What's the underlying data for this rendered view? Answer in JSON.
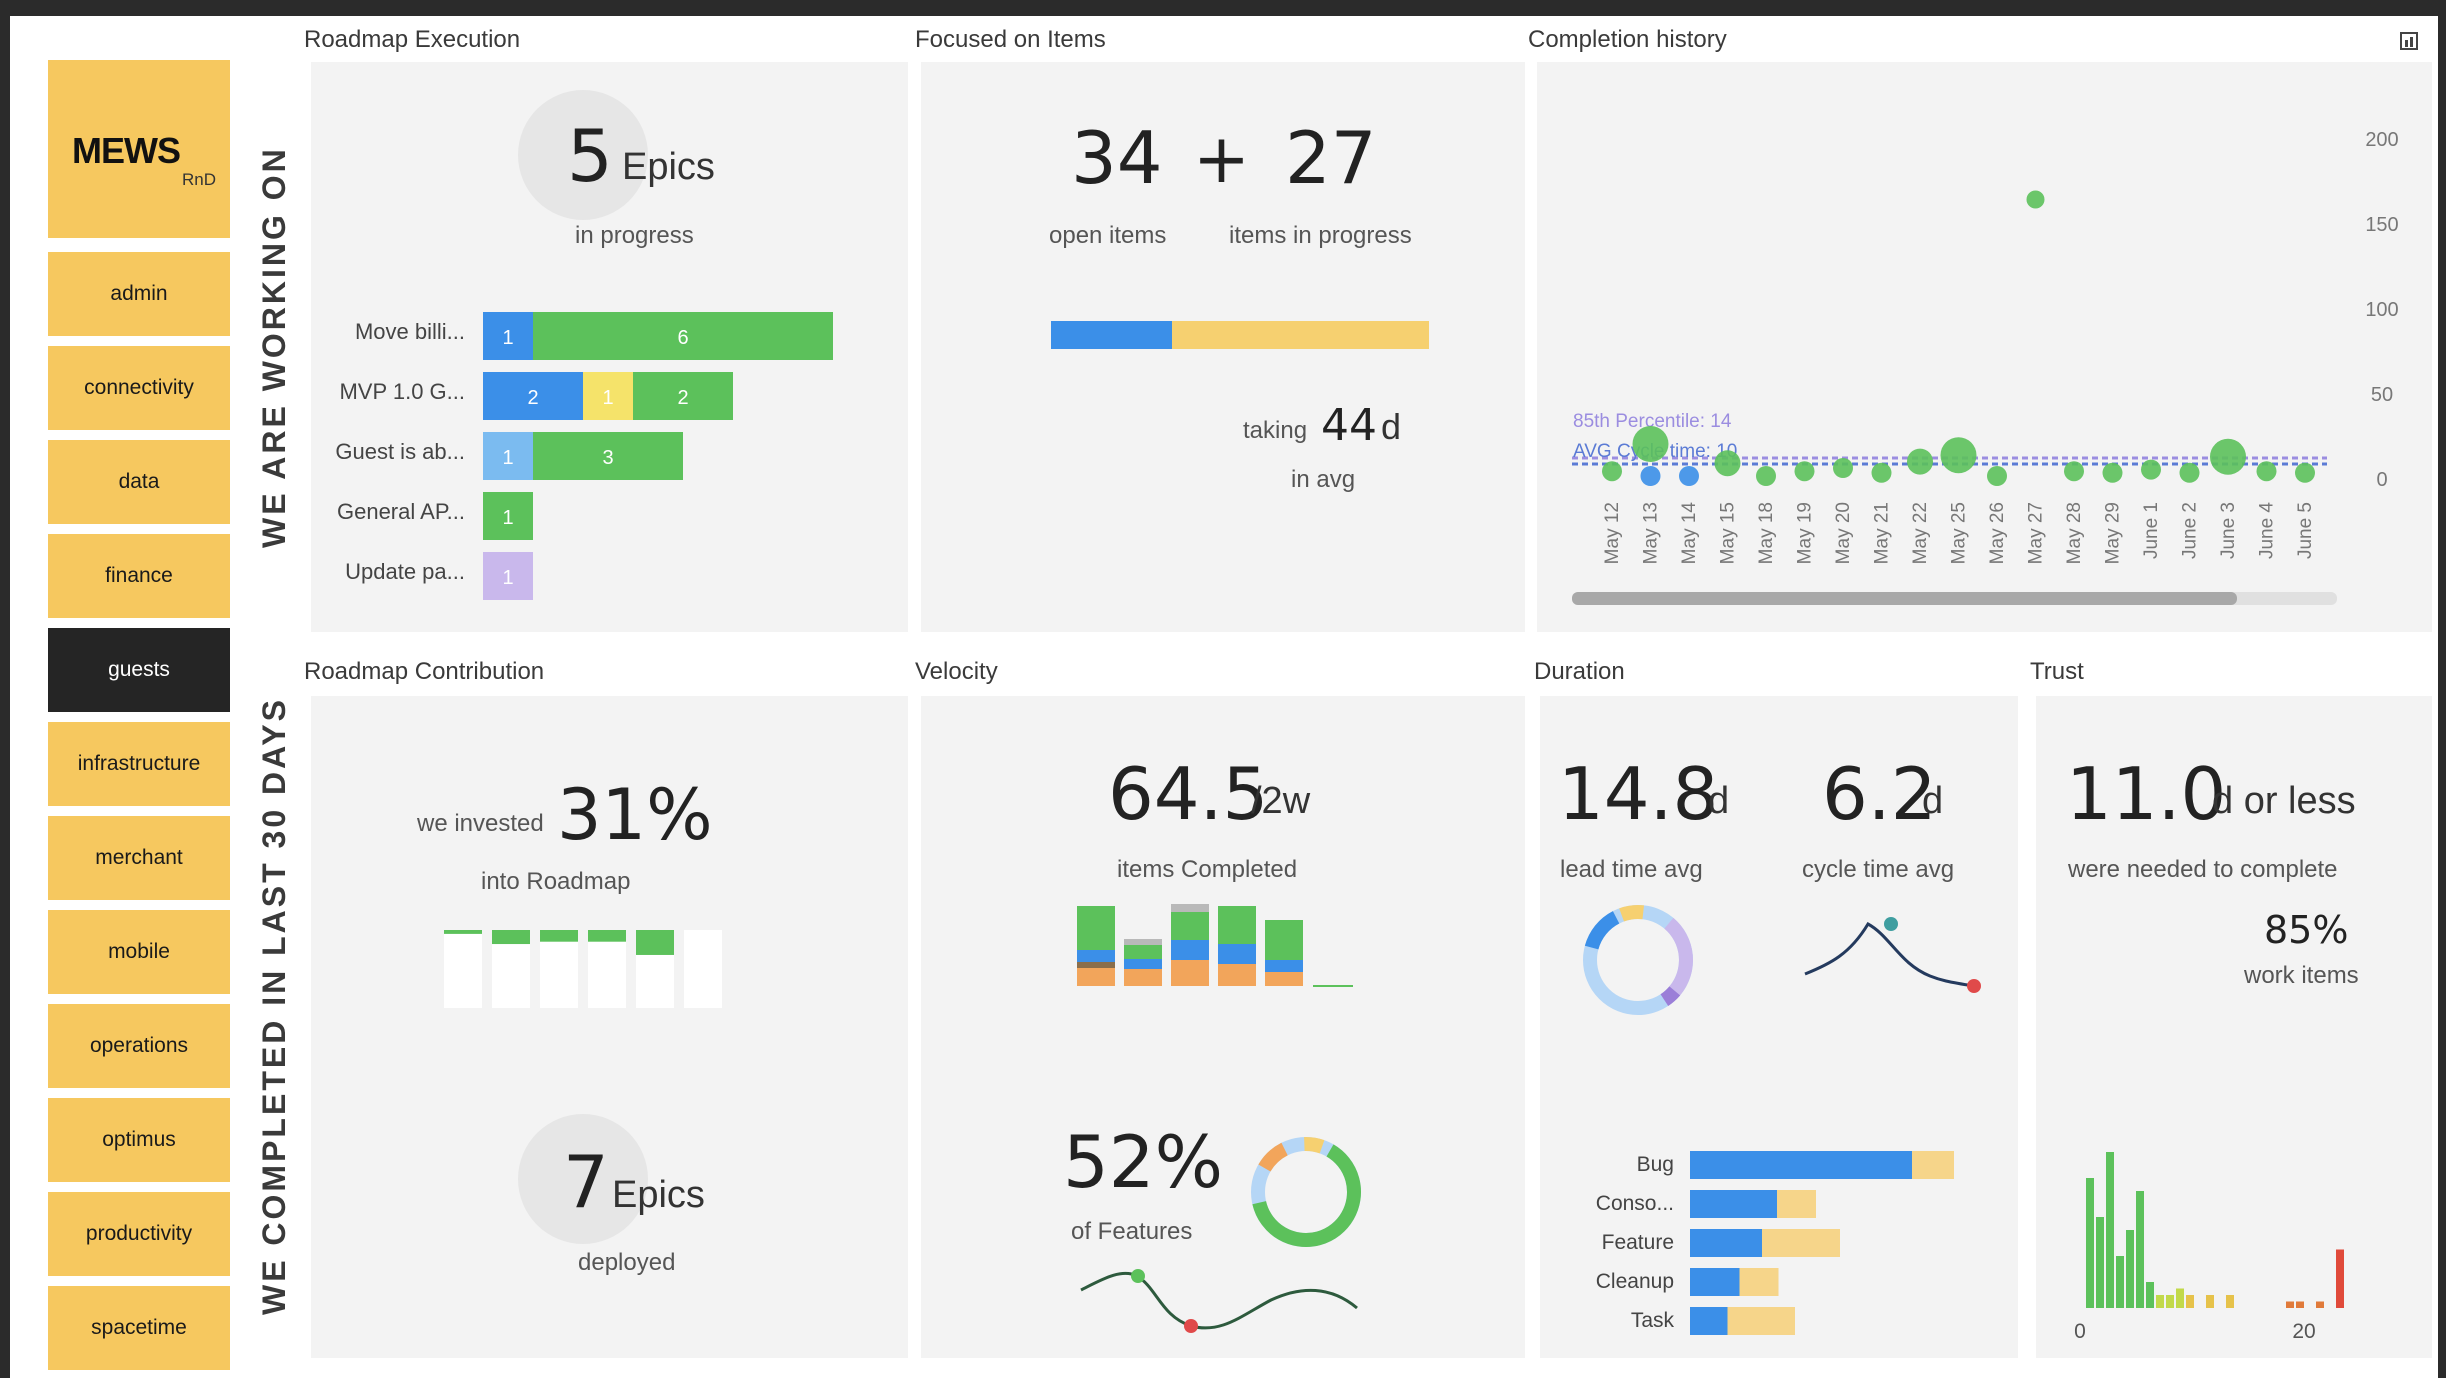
{
  "brand": {
    "name": "MEWS",
    "sub": "RnD"
  },
  "sidebar": {
    "items": [
      {
        "label": "admin",
        "active": false
      },
      {
        "label": "connectivity",
        "active": false
      },
      {
        "label": "data",
        "active": false
      },
      {
        "label": "finance",
        "active": false
      },
      {
        "label": "guests",
        "active": true
      },
      {
        "label": "infrastructure",
        "active": false
      },
      {
        "label": "merchant",
        "active": false
      },
      {
        "label": "mobile",
        "active": false
      },
      {
        "label": "operations",
        "active": false
      },
      {
        "label": "optimus",
        "active": false
      },
      {
        "label": "productivity",
        "active": false
      },
      {
        "label": "spacetime",
        "active": false
      }
    ]
  },
  "side_labels": {
    "working": "WE ARE WORKING ON",
    "completed": "WE COMPLETED IN LAST 30 DAYS"
  },
  "roadmap_execution": {
    "title": "Roadmap Execution",
    "count": "5",
    "unit": "Epics",
    "caption": "in progress",
    "bars": [
      {
        "label": "Move billi...",
        "segments": [
          {
            "value": 1,
            "color": "#3b8fe8"
          },
          {
            "value": 6,
            "color": "#5cc15b"
          }
        ]
      },
      {
        "label": "MVP 1.0 G...",
        "segments": [
          {
            "value": 2,
            "color": "#3b8fe8"
          },
          {
            "value": 1,
            "color": "#f5e36a"
          },
          {
            "value": 2,
            "color": "#5cc15b"
          }
        ]
      },
      {
        "label": "Guest is ab...",
        "segments": [
          {
            "value": 1,
            "color": "#7bbbf0"
          },
          {
            "value": 3,
            "color": "#5cc15b"
          }
        ]
      },
      {
        "label": "General AP...",
        "segments": [
          {
            "value": 1,
            "color": "#5cc15b"
          }
        ]
      },
      {
        "label": "Update pa...",
        "segments": [
          {
            "value": 1,
            "color": "#c9b8ec"
          }
        ]
      }
    ]
  },
  "focused": {
    "title": "Focused on Items",
    "open_count": "34",
    "plus": "+",
    "progress_count": "27",
    "open_label": "open items",
    "progress_label": "items in progress",
    "open_fraction": 0.32,
    "taking_label": "taking",
    "avg_days": "44",
    "avg_unit": "d",
    "avg_label": "in avg"
  },
  "completion_history": {
    "title": "Completion history",
    "chart_data": {
      "type": "scatter",
      "x": [
        "May 12",
        "May 13",
        "May 14",
        "May 15",
        "May 18",
        "May 19",
        "May 20",
        "May 21",
        "May 22",
        "May 25",
        "May 26",
        "May 27",
        "May 28",
        "May 29",
        "June 1",
        "June 2",
        "June 3",
        "June 4",
        "June 5"
      ],
      "ylim": [
        0,
        200
      ],
      "yticks": [
        "200",
        "150",
        "100",
        "50",
        "0"
      ],
      "reference_lines": [
        {
          "label": "85th Percentile: 14",
          "value": 14,
          "color": "#9b8de0"
        },
        {
          "label": "AVG Cycle time: 10",
          "value": 10,
          "color": "#5b7bd5"
        }
      ],
      "points": [
        {
          "x": "May 12",
          "y": 3,
          "color": "#5cc15b"
        },
        {
          "x": "May 13",
          "y": 20,
          "color": "#5cc15b"
        },
        {
          "x": "May 13",
          "y": 0,
          "color": "#3b8fe8"
        },
        {
          "x": "May 14",
          "y": 0,
          "color": "#3b8fe8"
        },
        {
          "x": "May 15",
          "y": 8,
          "color": "#5cc15b"
        },
        {
          "x": "May 18",
          "y": 0,
          "color": "#5cc15b"
        },
        {
          "x": "May 19",
          "y": 3,
          "color": "#5cc15b"
        },
        {
          "x": "May 20",
          "y": 5,
          "color": "#5cc15b"
        },
        {
          "x": "May 21",
          "y": 2,
          "color": "#5cc15b"
        },
        {
          "x": "May 22",
          "y": 9,
          "color": "#5cc15b"
        },
        {
          "x": "May 25",
          "y": 13,
          "color": "#5cc15b"
        },
        {
          "x": "May 26",
          "y": 0,
          "color": "#5cc15b"
        },
        {
          "x": "May 27",
          "y": 165,
          "color": "#5cc15b"
        },
        {
          "x": "May 28",
          "y": 3,
          "color": "#5cc15b"
        },
        {
          "x": "May 29",
          "y": 2,
          "color": "#5cc15b"
        },
        {
          "x": "June 1",
          "y": 4,
          "color": "#5cc15b"
        },
        {
          "x": "June 2",
          "y": 2,
          "color": "#5cc15b"
        },
        {
          "x": "June 3",
          "y": 12,
          "color": "#5cc15b"
        },
        {
          "x": "June 4",
          "y": 3,
          "color": "#5cc15b"
        },
        {
          "x": "June 5",
          "y": 2,
          "color": "#5cc15b"
        }
      ]
    }
  },
  "roadmap_contribution": {
    "title": "Roadmap Contribution",
    "prefix": "we invested",
    "percent": "31%",
    "caption": "into Roadmap",
    "bars": [
      0.05,
      0.18,
      0.15,
      0.15,
      0.32,
      0.0
    ],
    "epics_count": "7",
    "epics_unit": "Epics",
    "epics_caption": "deployed"
  },
  "velocity": {
    "title": "Velocity",
    "value": "64.5",
    "unit": "/2w",
    "caption": "items Completed",
    "features_pct": "52%",
    "features_label": "of Features"
  },
  "duration": {
    "title": "Duration",
    "lead_value": "14.8",
    "lead_unit": "d",
    "lead_label": "lead time avg",
    "cycle_value": "6.2",
    "cycle_unit": "d",
    "cycle_label": "cycle time avg",
    "chart_data": {
      "type": "bar",
      "categories": [
        "Bug",
        "Conso...",
        "Feature",
        "Cleanup",
        "Task"
      ],
      "series": [
        {
          "values": [
            14.8,
            5.8,
            4.8,
            3.3,
            2.5
          ],
          "color": "#3b8fe8"
        },
        {
          "values": [
            2.8,
            2.6,
            5.2,
            2.6,
            4.5
          ],
          "color": "#f6d58a"
        }
      ]
    }
  },
  "trust": {
    "title": "Trust",
    "value": "11.0",
    "unit": "d or less",
    "caption": "were needed to complete",
    "pct": "85%",
    "pct_label": "work items",
    "chart_data": {
      "type": "bar",
      "xticks": [
        "0",
        "20"
      ],
      "values": [
        20,
        14,
        24,
        8,
        12,
        18,
        4,
        2,
        2,
        3,
        2,
        0,
        2,
        0,
        2,
        0,
        1,
        1,
        0,
        1,
        0,
        9
      ],
      "colors": [
        "#5cc15b",
        "#5cc15b",
        "#5cc15b",
        "#5cc15b",
        "#5cc15b",
        "#5cc15b",
        "#5cc15b",
        "#c2d94a",
        "#c2d94a",
        "#c2d94a",
        "#e6c24a",
        "#e6c24a",
        "#e6c24a",
        "#e6c24a",
        "#e6c24a",
        "#e6c24a",
        "#e07a3a",
        "#e07a3a",
        "#e07a3a",
        "#e07a3a",
        "#e07a3a",
        "#e04a3a"
      ]
    }
  }
}
